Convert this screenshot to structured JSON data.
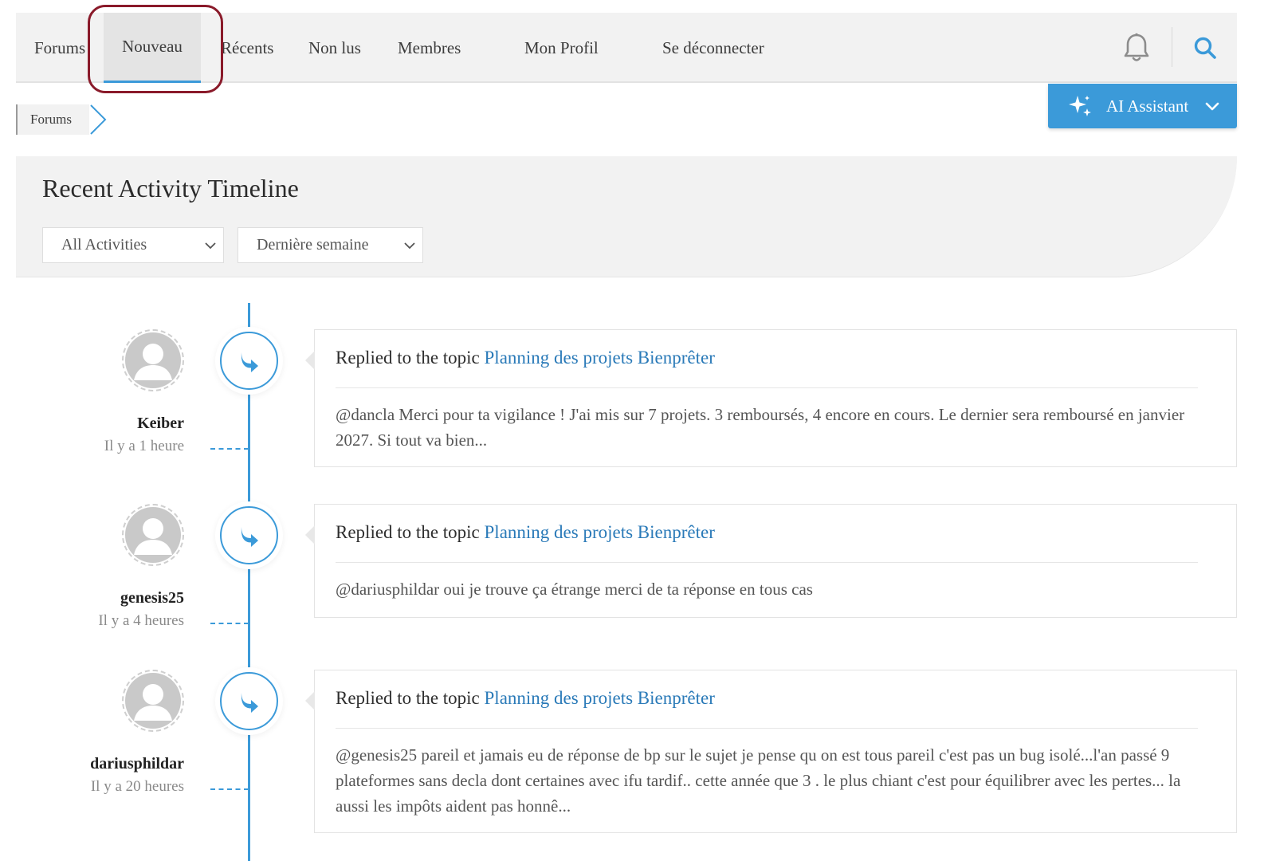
{
  "nav": {
    "items": [
      {
        "label": "Forums"
      },
      {
        "label": "Nouveau"
      },
      {
        "label": "Récents"
      },
      {
        "label": "Non lus"
      },
      {
        "label": "Membres"
      },
      {
        "label": "Mon Profil"
      },
      {
        "label": "Se déconnecter"
      }
    ],
    "active_item": "Nouveau",
    "icons": [
      "bell-icon",
      "search-icon"
    ]
  },
  "ai_assistant": {
    "label": "AI Assistant",
    "icon": "sparkle-icon"
  },
  "breadcrumb": {
    "items": [
      {
        "label": "Forums"
      }
    ]
  },
  "header": {
    "title": "Recent Activity Timeline",
    "filters": {
      "activity": "All Activities",
      "period": "Dernière semaine"
    }
  },
  "timeline": {
    "entries": [
      {
        "username": "Keiber",
        "time": "Il y a 1 heure",
        "action": "Replied to the topic",
        "topic": "Planning des projets Bienprêter",
        "excerpt": "@dancla Merci pour ta vigilance ! J'ai mis sur 7 projets. 3 remboursés, 4 encore en cours. Le dernier sera remboursé en janvier 2027. Si tout va bien..."
      },
      {
        "username": "genesis25",
        "time": "Il y a 4 heures",
        "action": "Replied to the topic",
        "topic": "Planning des projets Bienprêter",
        "excerpt": "@dariusphildar oui je trouve ça étrange merci de ta réponse en tous cas"
      },
      {
        "username": "dariusphildar",
        "time": "Il y a 20 heures",
        "action": "Replied to the topic",
        "topic": "Planning des projets Bienprêter",
        "excerpt": "@genesis25 pareil et jamais eu de réponse de bp sur le sujet je pense qu on est tous pareil c'est pas un bug isolé...l'an passé 9 plateformes sans decla dont certaines avec ifu tardif.. cette année que 3 . le plus chiant c'est pour équilibrer avec les pertes... la aussi les impôts aident pas honnê..."
      }
    ]
  },
  "colors": {
    "accent": "#3b9ad9",
    "link": "#2a7ab8",
    "highlight_ring": "#8a1a2a",
    "nav_bg": "#f2f2f2"
  }
}
